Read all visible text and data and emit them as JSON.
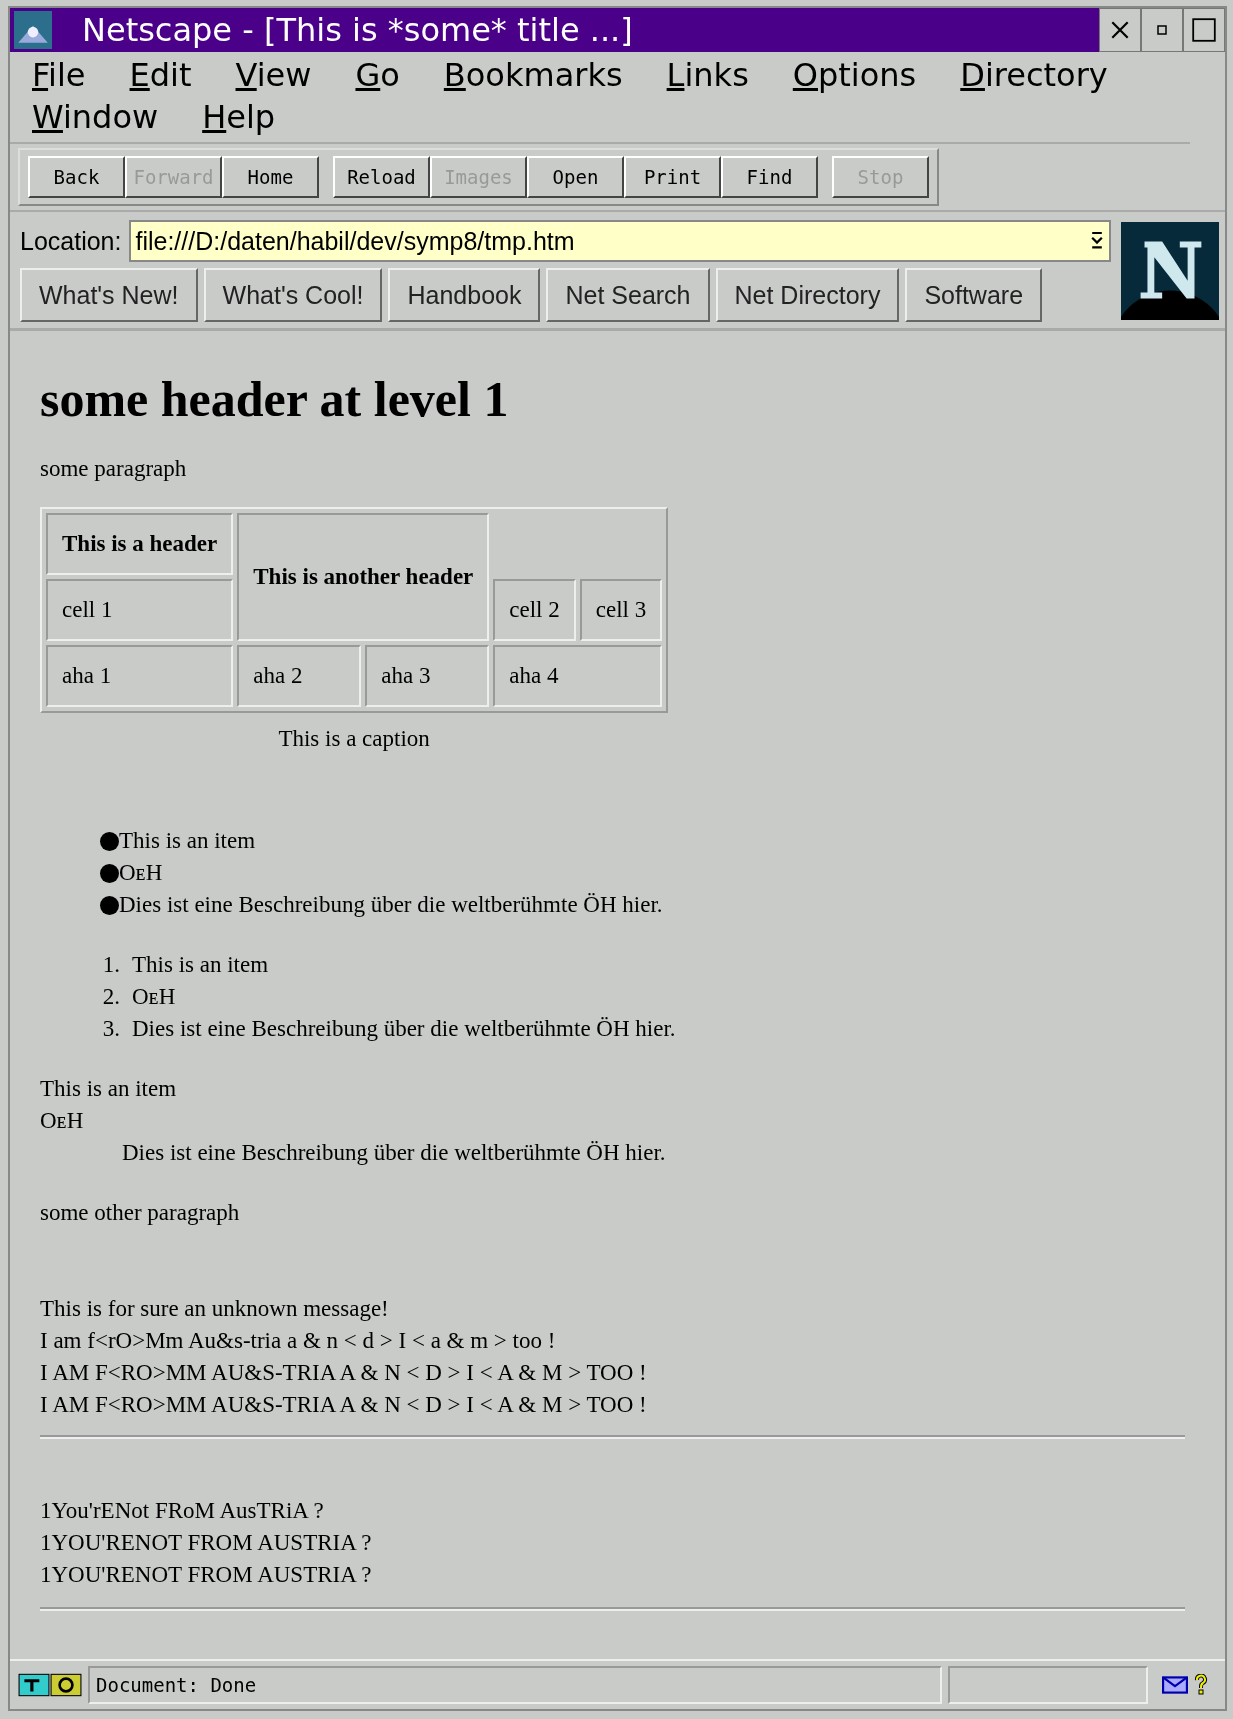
{
  "window": {
    "title": "Netscape - [This is *some* title ...]"
  },
  "menu": [
    {
      "label": "File"
    },
    {
      "label": "Edit"
    },
    {
      "label": "View"
    },
    {
      "label": "Go"
    },
    {
      "label": "Bookmarks"
    },
    {
      "label": "Links"
    },
    {
      "label": "Options"
    },
    {
      "label": "Directory"
    },
    {
      "label": "Window"
    },
    {
      "label": "Help"
    }
  ],
  "toolbar": {
    "groups": [
      {
        "buttons": [
          {
            "label": "Back",
            "disabled": false
          },
          {
            "label": "Forward",
            "disabled": true
          },
          {
            "label": "Home",
            "disabled": false
          }
        ]
      },
      {
        "buttons": [
          {
            "label": "Reload",
            "disabled": false
          },
          {
            "label": "Images",
            "disabled": true
          },
          {
            "label": "Open",
            "disabled": false
          },
          {
            "label": "Print",
            "disabled": false
          },
          {
            "label": "Find",
            "disabled": false
          }
        ]
      },
      {
        "buttons": [
          {
            "label": "Stop",
            "disabled": true
          }
        ]
      }
    ]
  },
  "location": {
    "label": "Location:",
    "value": "file:///D:/daten/habil/dev/symp8/tmp.htm"
  },
  "directory_buttons": [
    "What's New!",
    "What's Cool!",
    "Handbook",
    "Net Search",
    "Net Directory",
    "Software"
  ],
  "content": {
    "heading": "some header at level 1",
    "paragraph": "some paragraph",
    "table": {
      "rows": [
        [
          {
            "text": "This is a header",
            "kind": "header"
          },
          {
            "text": "This is another header",
            "kind": "header",
            "rowspan": 2,
            "colspan": 2
          }
        ],
        [
          {
            "text": "cell 1",
            "kind": "data"
          },
          {
            "text": "cell 2",
            "kind": "data"
          },
          {
            "text": "cell 3",
            "kind": "data"
          }
        ],
        [
          {
            "text": "aha 1",
            "kind": "data"
          },
          {
            "text": "aha 2",
            "kind": "data"
          },
          {
            "text": "aha 3",
            "kind": "data"
          },
          {
            "text": "aha 4",
            "kind": "data",
            "colspan": 2
          }
        ]
      ],
      "caption": "This is a caption"
    },
    "bullet_list": [
      "This is an item",
      "OᴇH",
      "Dies ist eine Beschreibung über die weltberühmte ÖH hier."
    ],
    "ordered_list": [
      {
        "number": "1.",
        "text": "This is an item"
      },
      {
        "number": "2.",
        "text": "OᴇH"
      },
      {
        "number": "3.",
        "text": "Dies ist eine Beschreibung über die weltberühmte ÖH hier."
      }
    ],
    "definition_list": [
      {
        "term": "This is an item"
      },
      {
        "term": "OᴇH",
        "definition": "Dies ist eine Beschreibung über die weltberühmte ÖH hier."
      }
    ],
    "other_paragraph": "some other paragraph",
    "message_lines": [
      "This is for sure an unknown message!",
      "I am f<rO>Mm Au&s-tria a & n < d > I < a & m > too !",
      "I AM F<RO>MM AU&S-TRIA A & N < D > I < A & M > TOO !",
      "I AM F<RO>MM AU&S-TRIA A & N < D > I < A & M > TOO !"
    ],
    "austria_lines": [
      "1You'rENot FRoM AusTRiA ?",
      "1YOU'RENOT FROM AUSTRIA ?",
      "1YOU'RENOT FROM AUSTRIA ?"
    ]
  },
  "status_bar": {
    "text": "Document: Done"
  }
}
